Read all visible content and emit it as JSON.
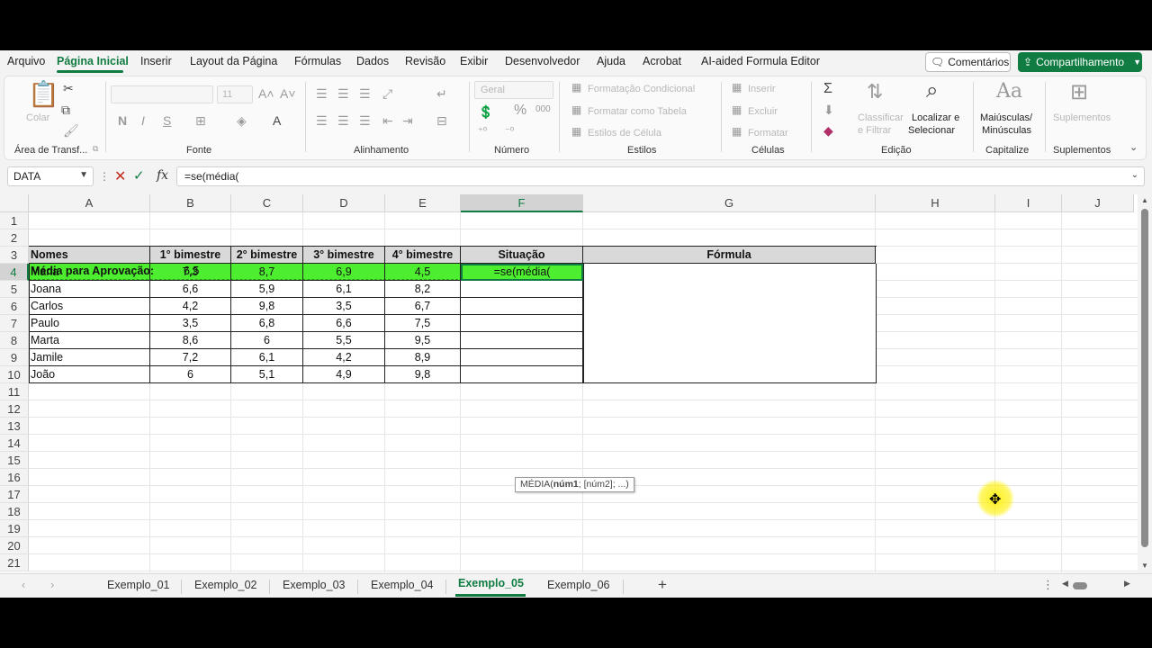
{
  "menu": {
    "items": [
      "Arquivo",
      "Página Inicial",
      "Inserir",
      "Layout da Página",
      "Fórmulas",
      "Dados",
      "Revisão",
      "Exibir",
      "Desenvolvedor",
      "Ajuda",
      "Acrobat",
      "AI-aided Formula Editor"
    ],
    "active": "Página Inicial",
    "comments": "Comentários",
    "share": "Compartilhamento"
  },
  "ribbon": {
    "clipboard": {
      "paste": "Colar",
      "label": "Área de Transf..."
    },
    "font": {
      "size": "11",
      "label": "Fonte"
    },
    "alignment": {
      "label": "Alinhamento"
    },
    "number": {
      "format": "Geral",
      "label": "Número"
    },
    "styles": {
      "conditional": "Formatação Condicional",
      "table": "Formatar como Tabela",
      "cell": "Estilos de Célula",
      "label": "Estilos"
    },
    "cells": {
      "insert": "Inserir",
      "delete": "Excluir",
      "format": "Formatar",
      "label": "Células"
    },
    "editing": {
      "sort": "Classificar",
      "filter": "e Filtrar",
      "find": "Localizar e",
      "select": "Selecionar",
      "label": "Edição"
    },
    "capitalize": {
      "line1": "Maiúsculas/",
      "line2": "Minúsculas",
      "label": "Capitalize"
    },
    "addins": {
      "line1": "Suplementos",
      "label": "Suplementos"
    }
  },
  "formula_bar": {
    "name_box": "DATA",
    "formula": "=se(média("
  },
  "columns": [
    "A",
    "B",
    "C",
    "D",
    "E",
    "F",
    "G",
    "H",
    "I",
    "J"
  ],
  "rows": [
    "1",
    "2",
    "3",
    "4",
    "5",
    "6",
    "7",
    "8",
    "9",
    "10",
    "11",
    "12",
    "13",
    "14",
    "15",
    "16",
    "17",
    "18",
    "19",
    "20",
    "21"
  ],
  "sheet": {
    "approval_label": "Média para Aprovação:",
    "approval_value": "6,5",
    "headers": [
      "Nomes",
      "1° bimestre",
      "2° bimestre",
      "3° bimestre",
      "4° bimestre",
      "Situação",
      "Fórmula"
    ],
    "students": [
      {
        "name": "Maria",
        "b1": "7,3",
        "b2": "8,7",
        "b3": "6,9",
        "b4": "4,5"
      },
      {
        "name": "Joana",
        "b1": "6,6",
        "b2": "5,9",
        "b3": "6,1",
        "b4": "8,2"
      },
      {
        "name": "Carlos",
        "b1": "4,2",
        "b2": "9,8",
        "b3": "3,5",
        "b4": "6,7"
      },
      {
        "name": "Paulo",
        "b1": "3,5",
        "b2": "6,8",
        "b3": "6,6",
        "b4": "7,5"
      },
      {
        "name": "Marta",
        "b1": "8,6",
        "b2": "6",
        "b3": "5,5",
        "b4": "9,5"
      },
      {
        "name": "Jamile",
        "b1": "7,2",
        "b2": "6,1",
        "b3": "4,2",
        "b4": "8,9"
      },
      {
        "name": "João",
        "b1": "6",
        "b2": "5,1",
        "b3": "4,9",
        "b4": "9,8"
      }
    ],
    "editing_cell": "=se(média(",
    "tooltip": {
      "fn": "MÉDIA(",
      "arg1": "núm1",
      "rest": "; [núm2]; ...)"
    }
  },
  "sheet_tabs": [
    "Exemplo_01",
    "Exemplo_02",
    "Exemplo_03",
    "Exemplo_04",
    "Exemplo_05",
    "Exemplo_06"
  ],
  "active_tab": "Exemplo_05",
  "colors": {
    "accent": "#107c41",
    "highlight": "#4ded2f",
    "cursor": "#fff000"
  }
}
